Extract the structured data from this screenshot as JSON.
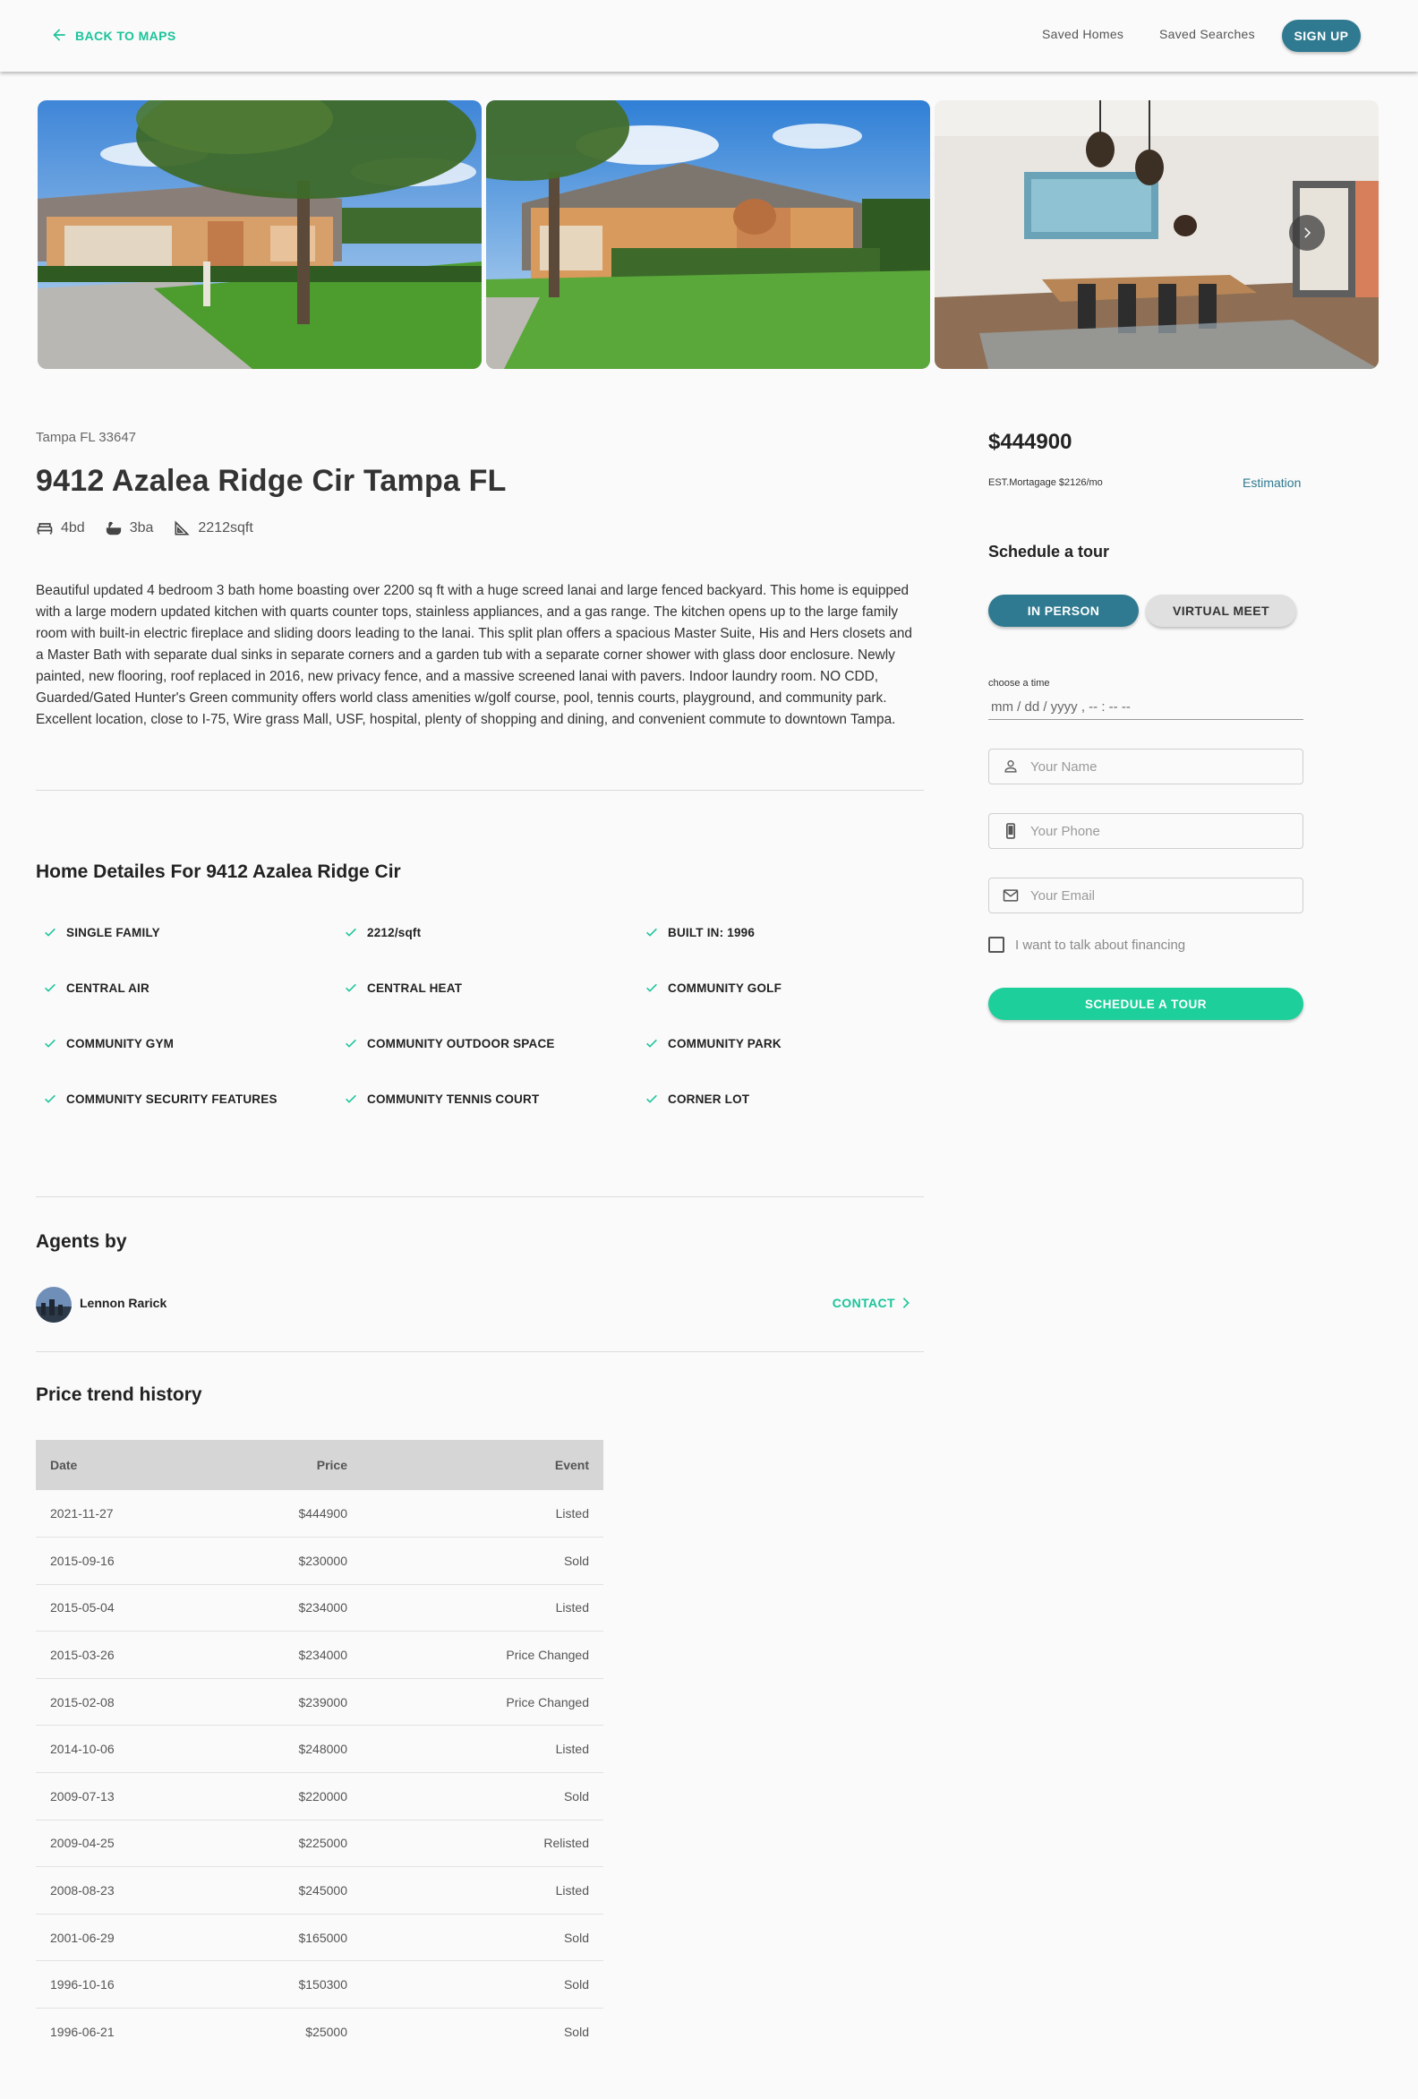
{
  "header": {
    "back_label": "BACK TO MAPS",
    "nav": [
      "Saved Homes",
      "Saved Searches"
    ],
    "signup_label": "SIGN UP"
  },
  "property": {
    "location": "Tampa FL 33647",
    "title": "9412 Azalea Ridge Cir Tampa FL",
    "beds": "4bd",
    "baths": "3ba",
    "area": "2212sqft",
    "description": "Beautiful updated 4 bedroom 3 bath home boasting over 2200 sq ft with a huge screed lanai and large fenced backyard. This home is equipped with a large modern updated kitchen with quarts counter tops, stainless appliances, and a gas range. The kitchen opens up to the large family room with built-in electric fireplace and sliding doors leading to the lanai. This split plan offers a spacious Master Suite, His and Hers closets and a Master Bath with separate dual sinks in separate corners and a garden tub with a separate corner shower with glass door enclosure. Newly painted, new flooring, roof replaced in 2016, new privacy fence, and a massive screened lanai with pavers. Indoor laundry room. NO CDD, Guarded/Gated Hunter's Green community offers world class amenities w/golf course, pool, tennis courts, playground, and community park. Excellent location, close to I-75, Wire grass Mall, USF, hospital, plenty of shopping and dining, and convenient commute to downtown Tampa."
  },
  "details": {
    "title": "Home Detailes For 9412 Azalea Ridge Cir",
    "items": [
      "SINGLE FAMILY",
      "2212/sqft",
      "BUILT IN: 1996",
      "CENTRAL AIR",
      "CENTRAL HEAT",
      "COMMUNITY GOLF",
      "COMMUNITY GYM",
      "COMMUNITY OUTDOOR SPACE",
      "COMMUNITY PARK",
      "COMMUNITY SECURITY FEATURES",
      "COMMUNITY TENNIS COURT",
      "CORNER LOT"
    ]
  },
  "agents": {
    "title": "Agents by",
    "name": "Lennon Rarick",
    "contact_label": "CONTACT"
  },
  "history": {
    "title": "Price trend history",
    "headers": {
      "date": "Date",
      "price": "Price",
      "event": "Event"
    },
    "rows": [
      {
        "date": "2021-11-27",
        "price": "$444900",
        "event": "Listed"
      },
      {
        "date": "2015-09-16",
        "price": "$230000",
        "event": "Sold"
      },
      {
        "date": "2015-05-04",
        "price": "$234000",
        "event": "Listed"
      },
      {
        "date": "2015-03-26",
        "price": "$234000",
        "event": "Price Changed"
      },
      {
        "date": "2015-02-08",
        "price": "$239000",
        "event": "Price Changed"
      },
      {
        "date": "2014-10-06",
        "price": "$248000",
        "event": "Listed"
      },
      {
        "date": "2009-07-13",
        "price": "$220000",
        "event": "Sold"
      },
      {
        "date": "2009-04-25",
        "price": "$225000",
        "event": "Relisted"
      },
      {
        "date": "2008-08-23",
        "price": "$245000",
        "event": "Listed"
      },
      {
        "date": "2001-06-29",
        "price": "$165000",
        "event": "Sold"
      },
      {
        "date": "1996-10-16",
        "price": "$150300",
        "event": "Sold"
      },
      {
        "date": "1996-06-21",
        "price": "$25000",
        "event": "Sold"
      }
    ]
  },
  "sidebar": {
    "price": "$444900",
    "mortgage": "EST.Mortagage $2126/mo",
    "estimation_label": "Estimation",
    "tour_title": "Schedule a tour",
    "in_person_label": "IN PERSON",
    "virtual_label": "VIRTUAL MEET",
    "time_label": "choose a time",
    "time_placeholder": "mm / dd / yyyy ,  -- : --   --",
    "name_placeholder": "Your Name",
    "phone_placeholder": "Your Phone",
    "email_placeholder": "Your Email",
    "financing_label": "I want to talk about financing",
    "schedule_label": "SCHEDULE A TOUR"
  },
  "colors": {
    "accent_green": "#1dcf9a",
    "primary_teal": "#2f7a90",
    "table_header": "#d6d6d6"
  },
  "icons": [
    "arrow-left-icon",
    "chevron-right-icon",
    "bed-icon",
    "bath-icon",
    "ruler-icon",
    "check-icon",
    "person-icon",
    "phone-icon",
    "mail-icon"
  ]
}
